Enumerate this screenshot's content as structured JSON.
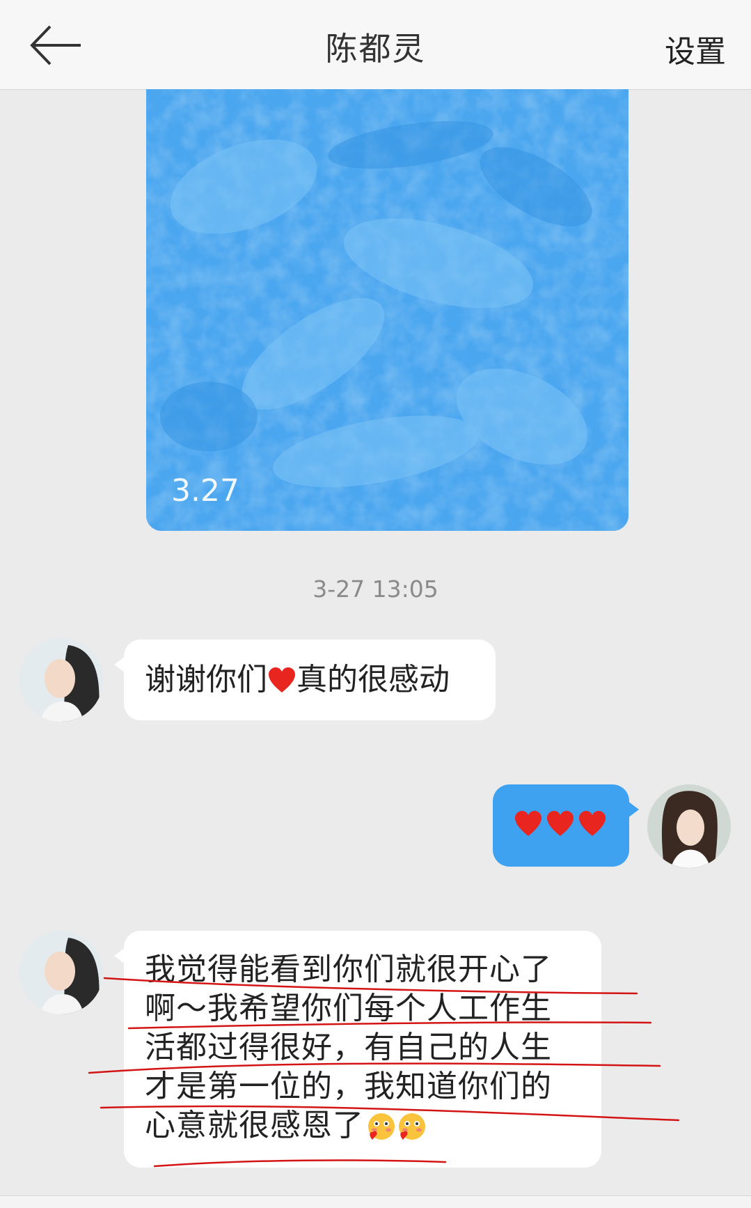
{
  "header": {
    "title": "陈都灵",
    "settings_label": "设置",
    "back_icon": "arrow-left-icon"
  },
  "image_message": {
    "date_label": "3.27",
    "background_color": "#4aa6ef"
  },
  "timestamp": "3-27 13:05",
  "messages": [
    {
      "direction": "incoming",
      "text_before_icon": "谢谢你们",
      "icon": "heart-icon",
      "text_after_icon": "真的很感动"
    },
    {
      "direction": "outgoing",
      "icons": [
        "heart-icon",
        "heart-icon",
        "heart-icon"
      ]
    },
    {
      "direction": "incoming",
      "lines": [
        "我觉得能看到你们就很开心了",
        "啊～我希望你们每个人工作生",
        "活都过得很好，有自己的人生",
        "才是第一位的，我知道你们的",
        "心意就很感恩了"
      ],
      "trailing_icons": [
        "blushing-face-icon",
        "blushing-face-icon"
      ]
    }
  ],
  "colors": {
    "incoming_bubble": "#ffffff",
    "outgoing_bubble": "#3fa2f1",
    "heart": "#e8251f",
    "annotation_red": "#d41414",
    "background": "#ebebeb"
  }
}
